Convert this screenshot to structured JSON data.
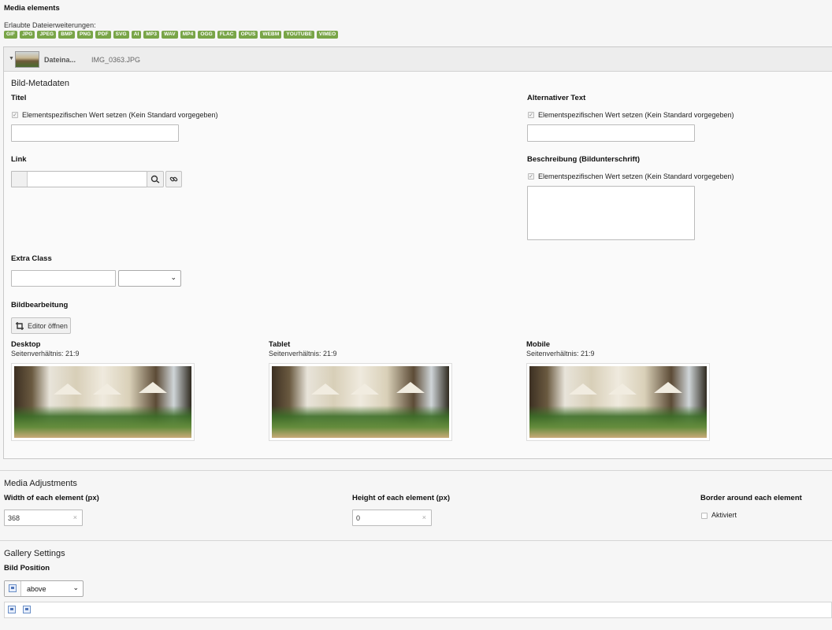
{
  "header": {
    "title": "Media elements",
    "allowed_extensions_label": "Erlaubte Dateierweiterungen:",
    "extensions": [
      "GIF",
      "JPG",
      "JPEG",
      "BMP",
      "PNG",
      "PDF",
      "SVG",
      "AI",
      "MP3",
      "WAV",
      "MP4",
      "OGG",
      "FLAC",
      "OPUS",
      "WEBM",
      "YOUTUBE",
      "VIMEO"
    ]
  },
  "file_panel": {
    "file_label": "Dateina...",
    "file_name": "IMG_0363.JPG",
    "metadata_title": "Bild-Metadaten",
    "titel": {
      "label": "Titel",
      "checkbox_label": "Elementspezifischen Wert setzen (Kein Standard vorgegeben)",
      "value": ""
    },
    "alt_text": {
      "label": "Alternativer Text",
      "checkbox_label": "Elementspezifischen Wert setzen (Kein Standard vorgegeben)",
      "value": ""
    },
    "link": {
      "label": "Link",
      "value": ""
    },
    "beschreibung": {
      "label": "Beschreibung (Bildunterschrift)",
      "checkbox_label": "Elementspezifischen Wert setzen (Kein Standard vorgegeben)",
      "value": ""
    },
    "extra_class": {
      "label": "Extra Class",
      "value": "",
      "select_value": ""
    },
    "bildbearbeitung": {
      "label": "Bildbearbeitung",
      "button_label": "Editor öffnen"
    },
    "crops": [
      {
        "name": "Desktop",
        "ratio": "Seitenverhältnis: 21:9"
      },
      {
        "name": "Tablet",
        "ratio": "Seitenverhältnis: 21:9"
      },
      {
        "name": "Mobile",
        "ratio": "Seitenverhältnis: 21:9"
      }
    ]
  },
  "media_adjustments": {
    "title": "Media Adjustments",
    "width_label": "Width of each element (px)",
    "width_value": "368",
    "height_label": "Height of each element (px)",
    "height_value": "0",
    "border_label": "Border around each element",
    "border_checkbox_label": "Aktiviert"
  },
  "gallery_settings": {
    "title": "Gallery Settings",
    "position_label": "Bild Position",
    "position_value": "above"
  },
  "icons": {
    "clear": "×",
    "chevron": "⌄",
    "check": "✓"
  },
  "colors": {
    "extension_badge": "#79a548",
    "panel_header": "#ededed",
    "background": "#f6f6f6"
  }
}
